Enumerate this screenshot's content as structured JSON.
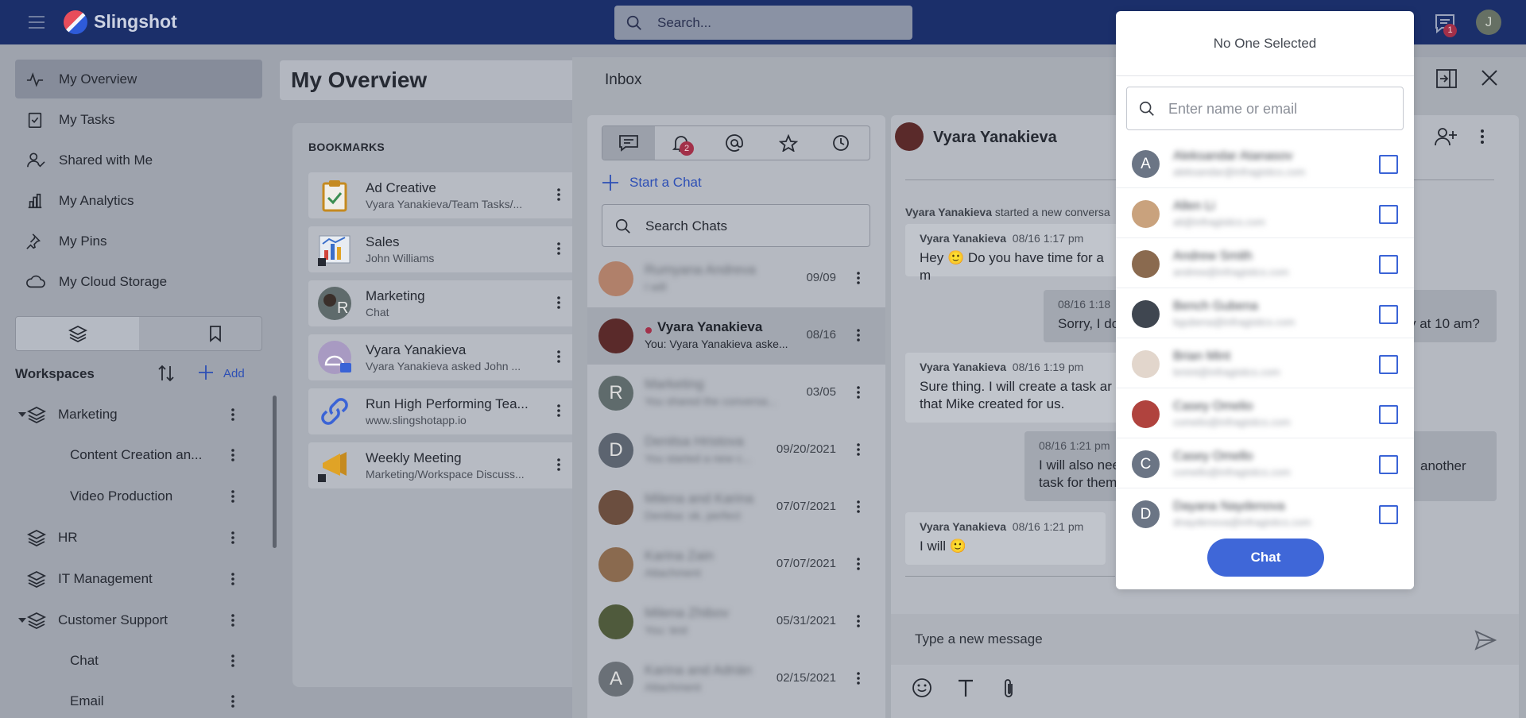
{
  "app": {
    "brand": "Slingshot",
    "search_placeholder": "Search...",
    "chat_badge": "1",
    "user_initial": "J"
  },
  "nav": {
    "items": [
      {
        "label": "My Overview",
        "icon": "pulse-icon",
        "active": true
      },
      {
        "label": "My Tasks",
        "icon": "checklist-icon"
      },
      {
        "label": "Shared with Me",
        "icon": "shared-user-icon"
      },
      {
        "label": "My Analytics",
        "icon": "bar-chart-icon"
      },
      {
        "label": "My Pins",
        "icon": "pin-icon"
      },
      {
        "label": "My Cloud Storage",
        "icon": "cloud-icon"
      }
    ]
  },
  "workspaces": {
    "title": "Workspaces",
    "add_label": "Add",
    "tree": [
      {
        "label": "Marketing",
        "level": 0,
        "expanded": true
      },
      {
        "label": "Content Creation an...",
        "level": 1
      },
      {
        "label": "Video Production",
        "level": 1
      },
      {
        "label": "HR",
        "level": 0
      },
      {
        "label": "IT Management",
        "level": 0
      },
      {
        "label": "Customer Support",
        "level": 0,
        "expanded": true
      },
      {
        "label": "Chat",
        "level": 1
      },
      {
        "label": "Email",
        "level": 1
      }
    ]
  },
  "overview": {
    "title": "My Overview",
    "bookmarks_title": "BOOKMARKS",
    "bookmarks": [
      {
        "title": "Ad Creative",
        "subtitle": "Vyara Yanakieva/Team Tasks/..."
      },
      {
        "title": "Sales",
        "subtitle": "John Williams"
      },
      {
        "title": "Marketing",
        "subtitle": "Chat"
      },
      {
        "title": "Vyara Yanakieva",
        "subtitle": "Vyara Yanakieva asked John ..."
      },
      {
        "title": "Run High Performing Tea...",
        "subtitle": "www.slingshotapp.io"
      },
      {
        "title": "Weekly Meeting",
        "subtitle": "Marketing/Workspace Discuss..."
      }
    ]
  },
  "inbox": {
    "title": "Inbox",
    "notif_badge": "2",
    "start_chat": "Start a Chat",
    "search_chats": "Search Chats",
    "chats": [
      {
        "name": "Rumyana Andreva",
        "preview": "I will",
        "date": "09/09",
        "blurred": true,
        "avatar_color": "#b0806a"
      },
      {
        "name": "Vyara Yanakieva",
        "preview": "You: Vyara Yanakieva aske...",
        "date": "08/16",
        "blurred": false,
        "selected": true,
        "avatar_color": "#5a2a2a"
      },
      {
        "name": "Marketing",
        "preview": "You shared the conversa...",
        "date": "03/05",
        "blurred": true,
        "avatar_color": "#5f6b6c",
        "initial": "R"
      },
      {
        "name": "Denitsa Hristova",
        "preview": "You started a new c...",
        "date": "09/20/2021",
        "blurred": true,
        "avatar_color": "#5c6470",
        "initial": "D"
      },
      {
        "name": "Milena and Karina",
        "preview": "Denitsa: ok, perfect",
        "date": "07/07/2021",
        "blurred": true,
        "avatar_color": "#6b4e3f"
      },
      {
        "name": "Karina Zain",
        "preview": "Attachment",
        "date": "07/07/2021",
        "blurred": true,
        "avatar_color": "#8a6a4f"
      },
      {
        "name": "Milena Zhibov",
        "preview": "You: test",
        "date": "05/31/2021",
        "blurred": true,
        "avatar_color": "#4f5a3c"
      },
      {
        "name": "Karina and Adrián",
        "preview": "Attachment",
        "date": "02/15/2021",
        "blurred": true,
        "avatar_color": "#6a7077",
        "initial": "A"
      }
    ]
  },
  "conversation": {
    "name": "Vyara Yanakieva",
    "system_message": {
      "author": "Vyara Yanakieva",
      "text": " started a new conversa"
    },
    "messages": [
      {
        "author": "Vyara Yanakieva",
        "time": "08/16 1:17 pm",
        "text": "Hey 🙂 Do you have time for a m"
      },
      {
        "author": "",
        "time": "08/16 1:18",
        "text": "Sorry, I do",
        "tail": "y at 10 am?"
      },
      {
        "author": "Vyara Yanakieva",
        "time": "08/16 1:19 pm",
        "text": "Sure thing. I will create a task ar",
        "text2": "that Mike created for us."
      },
      {
        "author": "",
        "time": "08/16 1:21 pm",
        "text": "I will also nee",
        "text2": "task for them",
        "tail": "another"
      },
      {
        "author": "Vyara Yanakieva",
        "time": "08/16 1:21 pm",
        "text": "I will 🙂"
      }
    ],
    "composer_placeholder": "Type a new message"
  },
  "popup": {
    "title": "No One Selected",
    "input_placeholder": "Enter name or email",
    "people": [
      {
        "initial": "A",
        "name": "Aleksandar Atanasov",
        "email": "aleksandar@infragistics.com",
        "color": "#6b7585"
      },
      {
        "initial": "",
        "name": "Allen Li",
        "email": "ali@infragistics.com",
        "color": "#c9a27d"
      },
      {
        "initial": "",
        "name": "Andrew Smith",
        "email": "andrew@infragistics.com",
        "color": "#8a6a4f"
      },
      {
        "initial": "",
        "name": "Bench Gubena",
        "email": "bgubena@infragistics.com",
        "color": "#3f4650"
      },
      {
        "initial": "",
        "name": "Brian Mint",
        "email": "bmint@infragistics.com",
        "color": "#e2d6cc"
      },
      {
        "initial": "",
        "name": "Casey Omelio",
        "email": "comelio@infragistics.com",
        "color": "#b0433e"
      },
      {
        "initial": "C",
        "name": "Casey Omello",
        "email": "comello@infragistics.com",
        "color": "#6b7585"
      },
      {
        "initial": "D",
        "name": "Dayana Naydenova",
        "email": "dnaydenova@infragistics.com",
        "color": "#6b7585"
      }
    ],
    "chat_button": "Chat"
  }
}
